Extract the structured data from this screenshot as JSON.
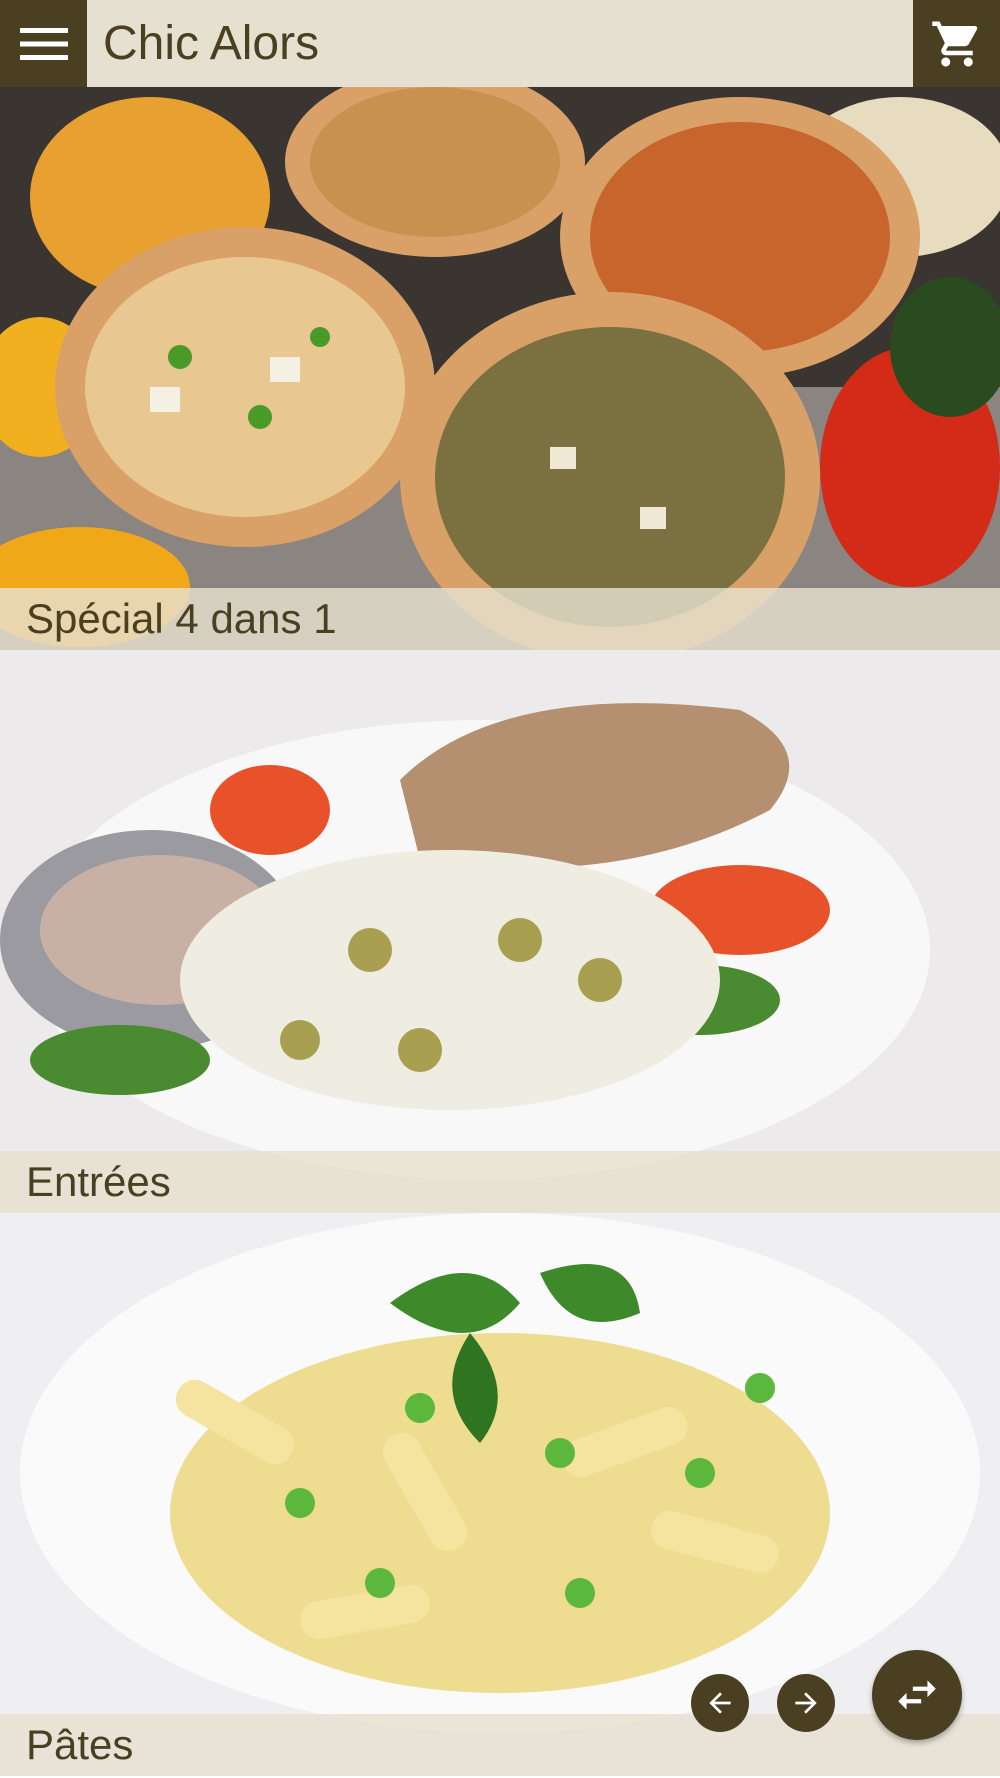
{
  "app": {
    "title": "Chic Alors",
    "menu_icon": "hamburger-menu-icon",
    "cart_icon": "shopping-cart-icon"
  },
  "categories": [
    {
      "label": "Spécial 4 dans 1",
      "image": "pizzas-photo"
    },
    {
      "label": "Entrées",
      "image": "salad-photo"
    },
    {
      "label": "Pâtes",
      "image": "pasta-photo"
    }
  ],
  "controls": {
    "prev_icon": "arrow-left-icon",
    "next_icon": "arrow-right-icon",
    "swap_icon": "swap-arrows-icon"
  },
  "colors": {
    "brand_dark": "#4a3f21",
    "bar_light": "#e6e0d0"
  }
}
